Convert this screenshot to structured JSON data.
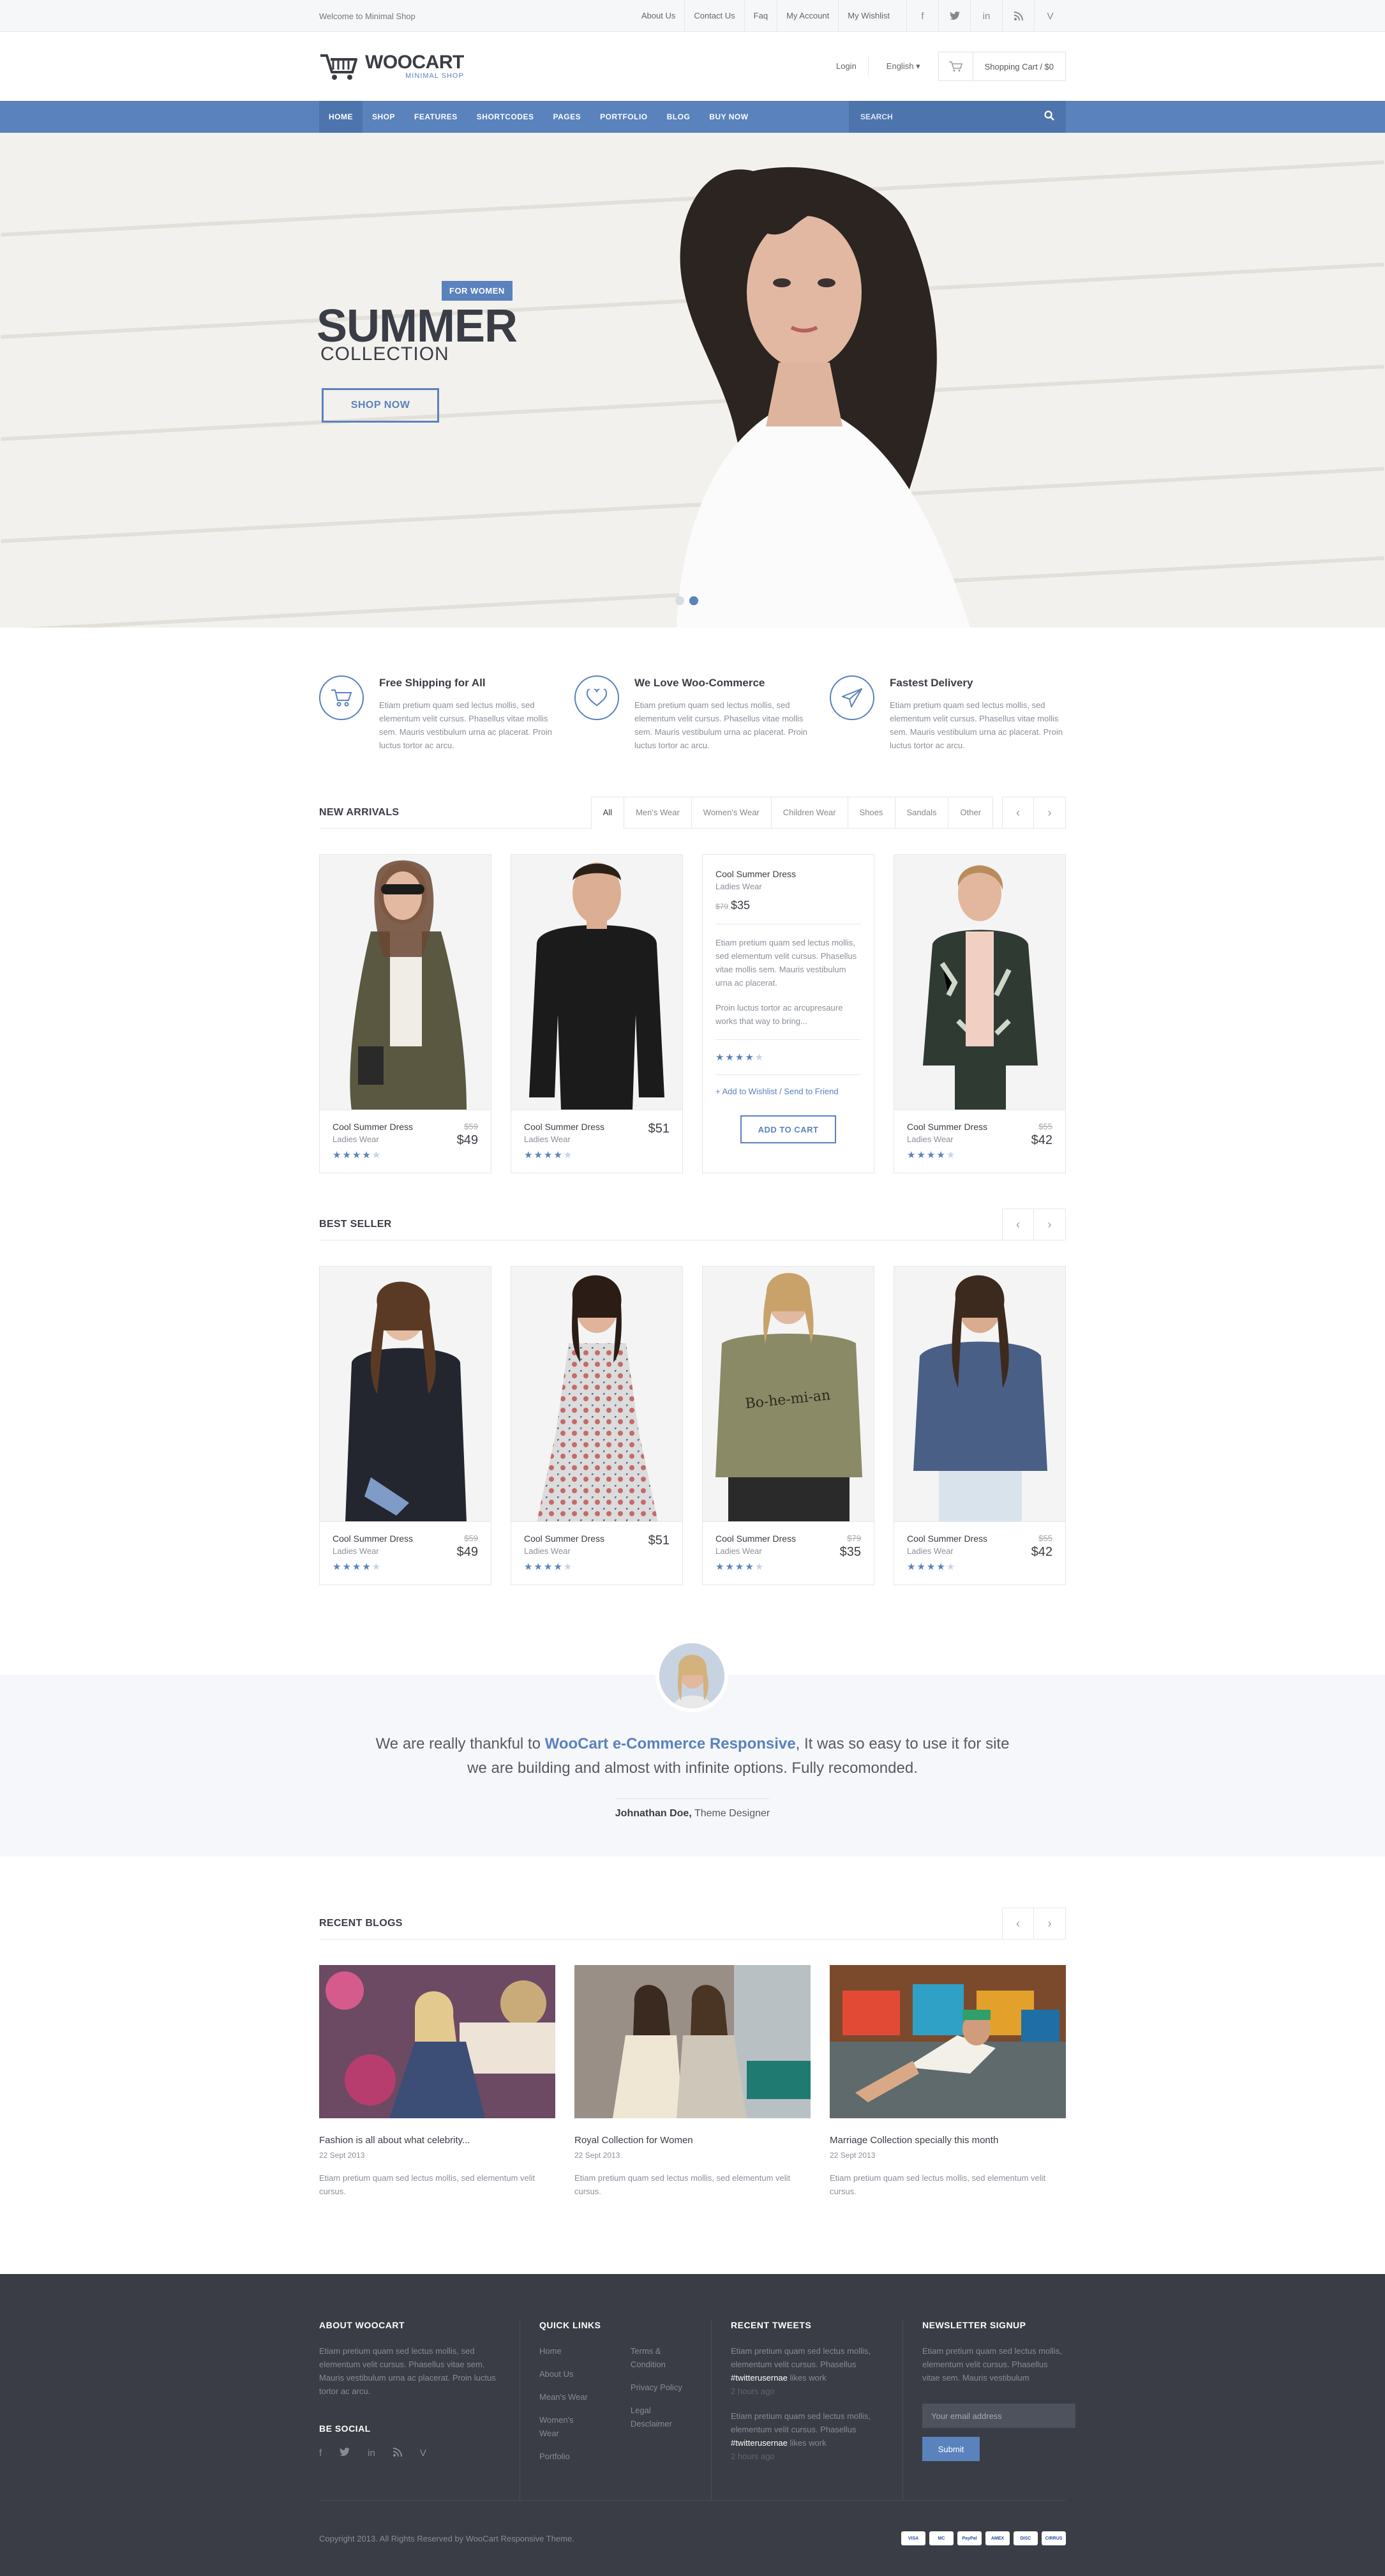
{
  "topbar": {
    "welcome": "Welcome to Minimal Shop",
    "links": [
      "About Us",
      "Contact Us",
      "Faq",
      "My Account",
      "My Wishlist"
    ],
    "socials": [
      "facebook-icon",
      "twitter-icon",
      "linkedin-icon",
      "rss-icon",
      "vimeo-icon"
    ]
  },
  "header": {
    "brand": "WOOCART",
    "tagline": "MINIMAL SHOP",
    "login": "Login",
    "language": "English",
    "cart": "Shopping Cart / $0"
  },
  "nav": {
    "items": [
      "HOME",
      "SHOP",
      "FEATURES",
      "SHORTCODES",
      "PAGES",
      "PORTFOLIO",
      "BLOG",
      "BUY NOW"
    ],
    "search_placeholder": "SEARCH"
  },
  "hero": {
    "badge": "FOR WOMEN",
    "title": "SUMMER",
    "subtitle": "COLLECTION",
    "cta": "SHOP NOW"
  },
  "features": [
    {
      "title": "Free Shipping for All",
      "text": "Etiam pretium quam sed lectus mollis, sed elementum velit cursus. Phasellus vitae mollis sem. Mauris vestibulum urna ac placerat. Proin luctus tortor ac arcu."
    },
    {
      "title": "We Love Woo-Commerce",
      "text": "Etiam pretium quam sed lectus mollis, sed elementum velit cursus. Phasellus vitae mollis sem. Mauris vestibulum urna ac placerat. Proin luctus tortor ac arcu."
    },
    {
      "title": "Fastest Delivery",
      "text": "Etiam pretium quam sed lectus mollis, sed elementum velit cursus. Phasellus vitae mollis sem. Mauris vestibulum urna ac placerat. Proin luctus tortor ac arcu."
    }
  ],
  "new_arrivals": {
    "title": "NEW ARRIVALS",
    "filters": [
      "All",
      "Men's Wear",
      "Women's Wear",
      "Children Wear",
      "Shoes",
      "Sandals",
      "Other"
    ],
    "products": [
      {
        "name": "Cool Summer Dress",
        "category": "Ladies Wear",
        "old": "$59",
        "price": "$49"
      },
      {
        "name": "Cool Summer Dress",
        "category": "Ladies Wear",
        "old": "",
        "price": "$51"
      },
      {
        "name": "Cool Summer Dress",
        "category": "Ladies Wear",
        "old": "$79",
        "price": "$35",
        "desc1": "Etiam pretium quam sed lectus mollis, sed elementum velit cursus. Phasellus vitae mollis sem. Mauris vestibulum urna ac placerat.",
        "desc2": "Proin luctus tortor ac arcupresaure works that way to bring...",
        "links": "+ Add to Wishlist / Send to Friend",
        "button": "ADD TO CART"
      },
      {
        "name": "Cool Summer Dress",
        "category": "Ladies Wear",
        "old": "$55",
        "price": "$42"
      }
    ]
  },
  "best_seller": {
    "title": "BEST SELLER",
    "products": [
      {
        "name": "Cool Summer Dress",
        "category": "Ladies Wear",
        "old": "$59",
        "price": "$49"
      },
      {
        "name": "Cool Summer Dress",
        "category": "Ladies Wear",
        "old": "",
        "price": "$51"
      },
      {
        "name": "Cool Summer Dress",
        "category": "Ladies Wear",
        "old": "$79",
        "price": "$35"
      },
      {
        "name": "Cool Summer Dress",
        "category": "Ladies Wear",
        "old": "$55",
        "price": "$42"
      }
    ]
  },
  "testimonial": {
    "pre": "We are really thankful to ",
    "highlight": "WooCart e-Commerce Responsive",
    "post": ", It was so easy to use it for site we are building and almost with infinite options. Fully recomonded.",
    "author": "Johnathan Doe,",
    "role": " Theme Designer"
  },
  "blogs": {
    "title": "RECENT BLOGS",
    "items": [
      {
        "title": "Fashion is all about what celebrity...",
        "date": "22 Sept 2013",
        "text": "Etiam pretium quam sed lectus mollis, sed elementum velit cursus."
      },
      {
        "title": "Royal Collection for Women",
        "date": "22 Sept 2013",
        "text": "Etiam pretium quam sed lectus mollis, sed elementum velit cursus."
      },
      {
        "title": "Marriage Collection specially this month",
        "date": "22 Sept 2013",
        "text": "Etiam pretium quam sed lectus mollis, sed elementum velit cursus."
      }
    ]
  },
  "footer": {
    "about_title": "ABOUT WOOCART",
    "about_text": "Etiam pretium quam sed lectus mollis, sed elementum velit cursus. Phasellus vitae sem. Mauris vestibulum urna ac placerat. Proin luctus tortor ac arcu.",
    "social_title": "BE SOCIAL",
    "links_title": "QUICK LINKS",
    "links_a": [
      "Home",
      "About Us",
      "Mean's Wear",
      "Women's Wear",
      "Portfolio"
    ],
    "links_b": [
      "Terms & Condition",
      "Privacy Policy",
      "Legal Desclaimer"
    ],
    "tweets_title": "RECENT TWEETS",
    "tweets": [
      {
        "text": "Etiam pretium quam sed lectus mollis, elementum velit cursus. Phasellus ",
        "handle": "#twitterusernae",
        "tail": " likes work",
        "ago": "2 hours ago"
      },
      {
        "text": "Etiam pretium quam sed lectus mollis, elementum velit cursus. Phasellus ",
        "handle": "#twitterusernae",
        "tail": " likes work",
        "ago": "2 hours ago"
      }
    ],
    "news_title": "NEWSLETTER SIGNUP",
    "news_text": "Etiam pretium quam sed lectus mollis, elementum velit cursus. Phasellus vitae sem. Mauris vestibulum",
    "email_placeholder": "Your email address",
    "submit": "Submit",
    "copyright": "Copyright 2013. All Rights Reserved by WooCart Responsive Theme.",
    "cards": [
      "VISA",
      "MC",
      "PayPal",
      "AMEX",
      "DISC",
      "CIRRUS"
    ]
  },
  "colors": {
    "accent": "#5a82bd",
    "dark": "#3a3d45",
    "footer": "#3a3d45"
  }
}
